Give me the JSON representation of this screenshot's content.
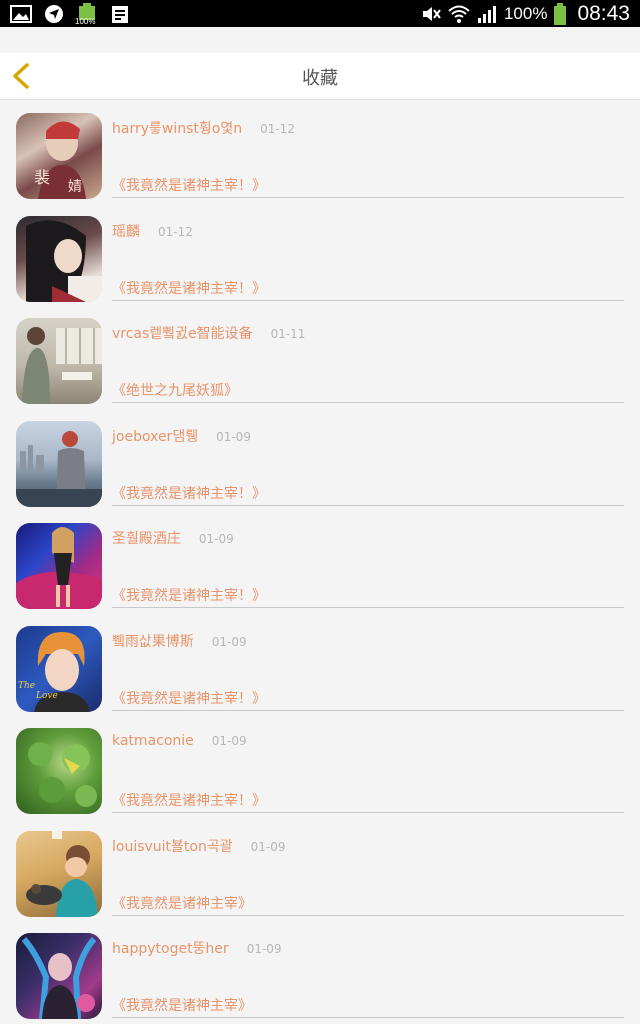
{
  "status_bar": {
    "icons_left": [
      "image-icon",
      "location-icon",
      "battery-full-icon",
      "clipboard-icon"
    ],
    "battery_small_label": "100%",
    "icons_right": [
      "mute-icon",
      "wifi-icon",
      "signal-icon",
      "battery-icon"
    ],
    "battery_percent": "100%",
    "time": "08:43"
  },
  "header": {
    "title": "收藏",
    "back_icon": "chevron-left-icon",
    "accent": "#e3b500"
  },
  "colors": {
    "accent_text": "#e8946a",
    "date_text": "#b7b7b7",
    "divider": "#c9c9c9"
  },
  "favorites": [
    {
      "user": "harry릏winst훵o옃n",
      "date": "01-12",
      "book": "《我竟然是诸神主宰！》",
      "avatar": "avatar-1"
    },
    {
      "user": "瑶麟",
      "date": "01-12",
      "book": "《我竟然是诸神主宰！》",
      "avatar": "avatar-2"
    },
    {
      "user": "vrcas렡쀀귌e智能设备",
      "date": "01-11",
      "book": "《绝世之九尾妖狐》",
      "avatar": "avatar-3"
    },
    {
      "user": "joeboxer댐뤵",
      "date": "01-09",
      "book": "《我竟然是诸神主宰！》",
      "avatar": "avatar-4"
    },
    {
      "user": "圣훨殿酒庄",
      "date": "01-09",
      "book": "《我竟然是诸神主宰！》",
      "avatar": "avatar-5"
    },
    {
      "user": "쀜雨삾果博斯",
      "date": "01-09",
      "book": "《我竟然是诸神主宰！》",
      "avatar": "avatar-6"
    },
    {
      "user": "katmaconie",
      "date": "01-09",
      "book": "《我竟然是诸神主宰！》",
      "avatar": "avatar-7"
    },
    {
      "user": "louisvuit뵬ton곡괄",
      "date": "01-09",
      "book": "《我竟然是诸神主宰》",
      "avatar": "avatar-8"
    },
    {
      "user": "happytoget뚱her",
      "date": "01-09",
      "book": "《我竟然是诸神主宰》",
      "avatar": "avatar-9"
    }
  ]
}
